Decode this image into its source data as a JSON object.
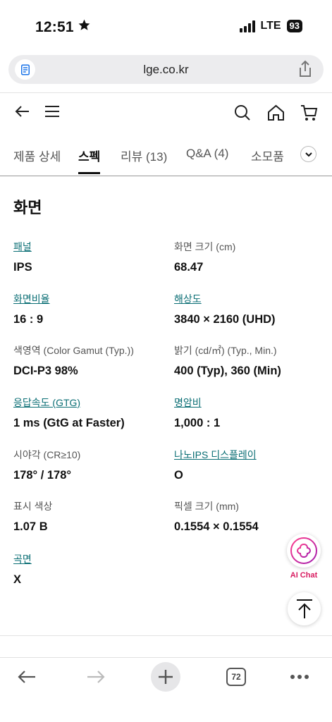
{
  "status": {
    "time": "12:51",
    "network": "LTE",
    "battery": "93"
  },
  "browser": {
    "url": "lge.co.kr",
    "tab_count": "72"
  },
  "tabs": [
    {
      "label": "제품 상세"
    },
    {
      "label": "스펙"
    },
    {
      "label": "리뷰 (13)"
    },
    {
      "label": "Q&A (4)"
    },
    {
      "label": "소모품"
    }
  ],
  "section": {
    "title": "화면"
  },
  "specs": [
    {
      "label": "패널",
      "value": "IPS"
    },
    {
      "label": "화면 크기 (cm)",
      "value": "68.47"
    },
    {
      "label": "화면비율",
      "value": "16 : 9"
    },
    {
      "label": "해상도",
      "value": "3840 × 2160 (UHD)"
    },
    {
      "label": "색영역 (Color Gamut (Typ.))",
      "value": "DCI-P3 98%"
    },
    {
      "label": "밝기 (cd/㎡) (Typ., Min.)",
      "value": "400 (Typ), 360 (Min)"
    },
    {
      "label": "응답속도 (GTG)",
      "value": "1 ms (GtG at Faster)"
    },
    {
      "label": "명암비",
      "value": "1,000 : 1"
    },
    {
      "label": "시야각 (CR≥10)",
      "value": "178° / 178°"
    },
    {
      "label": "나노IPS 디스플레이",
      "value": "O"
    },
    {
      "label": "표시 색상",
      "value": "1.07 B"
    },
    {
      "label": "픽셀 크기 (mm)",
      "value": "0.1554 × 0.1554"
    },
    {
      "label": "곡면",
      "value": "X"
    }
  ],
  "floating": {
    "ai_chat_label": "AI Chat"
  },
  "colors": {
    "link": "#0a6e74",
    "ai_accent": "#d81b60"
  }
}
